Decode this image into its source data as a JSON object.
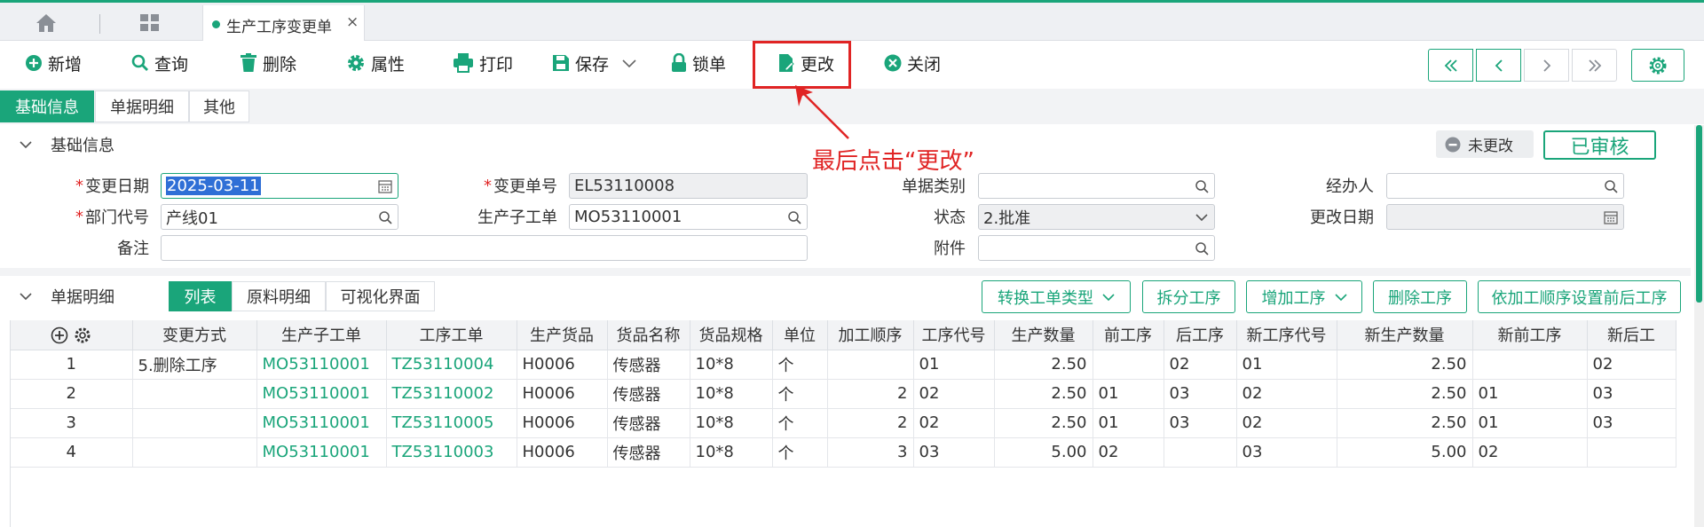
{
  "tabbar": {
    "active_tab": "生产工序变更单",
    "close": "×"
  },
  "toolbar": {
    "new": "新增",
    "query": "查询",
    "delete": "删除",
    "properties": "属性",
    "print": "打印",
    "save": "保存",
    "lock": "锁单",
    "modify": "更改",
    "close": "关闭"
  },
  "subtabs": [
    "基础信息",
    "单据明细",
    "其他"
  ],
  "basic": {
    "title": "基础信息",
    "status_badge": "未更改",
    "approved": "已审核",
    "annotation": "最后点击“更改”",
    "change_date_label": "变更日期",
    "change_date": "2025-03-11",
    "change_no_label": "变更单号",
    "change_no": "EL53110008",
    "doc_type_label": "单据类别",
    "doc_type": "",
    "handler_label": "经办人",
    "handler": "",
    "dept_label": "部门代号",
    "dept": "产线01",
    "sub_order_label": "生产子工单",
    "sub_order": "MO53110001",
    "state_label": "状态",
    "state": "2.批准",
    "modify_date_label": "更改日期",
    "modify_date": "",
    "remark_label": "备注",
    "remark": "",
    "attach_label": "附件",
    "attach": ""
  },
  "detail": {
    "title": "单据明细",
    "tabs": [
      "列表",
      "原料明细",
      "可视化界面"
    ],
    "actions": [
      "转换工单类型",
      "拆分工序",
      "增加工序",
      "删除工序",
      "依加工顺序设置前后工序"
    ],
    "columns": [
      "变更方式",
      "生产子工单",
      "工序工单",
      "生产货品",
      "货品名称",
      "货品规格",
      "单位",
      "加工顺序",
      "工序代号",
      "生产数量",
      "前工序",
      "后工序",
      "新工序代号",
      "新生产数量",
      "新前工序",
      "新后工"
    ],
    "rows": [
      {
        "no": "1",
        "mode": "5.删除工序",
        "sub": "MO53110001",
        "proc": "TZ53110004",
        "item": "H0006",
        "name": "传感器",
        "spec": "10*8",
        "unit": "个",
        "seq": "",
        "code": "01",
        "qty": "2.50",
        "prev": "",
        "next": "02",
        "ncode": "01",
        "nqty": "2.50",
        "nprev": "",
        "nnext": "02"
      },
      {
        "no": "2",
        "mode": "",
        "sub": "MO53110001",
        "proc": "TZ53110002",
        "item": "H0006",
        "name": "传感器",
        "spec": "10*8",
        "unit": "个",
        "seq": "2",
        "code": "02",
        "qty": "2.50",
        "prev": "01",
        "next": "03",
        "ncode": "02",
        "nqty": "2.50",
        "nprev": "01",
        "nnext": "03"
      },
      {
        "no": "3",
        "mode": "",
        "sub": "MO53110001",
        "proc": "TZ53110005",
        "item": "H0006",
        "name": "传感器",
        "spec": "10*8",
        "unit": "个",
        "seq": "2",
        "code": "02",
        "qty": "2.50",
        "prev": "01",
        "next": "03",
        "ncode": "02",
        "nqty": "2.50",
        "nprev": "01",
        "nnext": "03"
      },
      {
        "no": "4",
        "mode": "",
        "sub": "MO53110001",
        "proc": "TZ53110003",
        "item": "H0006",
        "name": "传感器",
        "spec": "10*8",
        "unit": "个",
        "seq": "3",
        "code": "03",
        "qty": "5.00",
        "prev": "02",
        "next": "",
        "ncode": "03",
        "nqty": "5.00",
        "nprev": "02",
        "nnext": ""
      }
    ]
  },
  "colors": {
    "accent": "#1aa57a",
    "highlight": "#e02424"
  }
}
